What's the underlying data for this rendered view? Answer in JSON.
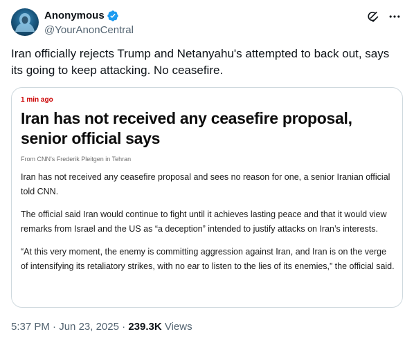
{
  "author": {
    "display_name": "Anonymous",
    "handle": "@YourAnonCentral"
  },
  "icons": {
    "avatar": "hooded-figure-avatar",
    "verified": "verified-badge-icon",
    "grok": "grok-icon",
    "more": "more-icon"
  },
  "colors": {
    "verified_blue": "#1d9bf0",
    "text_primary": "#0f1419",
    "text_secondary": "#536471",
    "card_border": "#cfd9de",
    "article_time_red": "#cc0000"
  },
  "tweet": {
    "text": "Iran officially rejects Trump and Netanyahu's attempted to back out, says its going to keep attacking. No ceasefire."
  },
  "card": {
    "time_ago": "1 min ago",
    "headline": "Iran has not received any ceasefire proposal, senior official says",
    "byline": "From CNN's Frederik Pleitgen in Tehran",
    "paragraphs": [
      "Iran has not received any ceasefire proposal and sees no reason for one, a senior Iranian official told CNN.",
      "The official said Iran would continue to fight until it achieves lasting peace and that it would view remarks from Israel and the US as “a deception” intended to justify attacks on Iran’s interests.",
      "“At this very moment, the enemy is committing aggression against Iran, and Iran is on the verge of intensifying its retaliatory strikes, with no ear to listen to the lies of its enemies,” the official said."
    ]
  },
  "meta": {
    "time": "5:37 PM",
    "date": "Jun 23, 2025",
    "separator": " · ",
    "views_count": "239.3K",
    "views_label": " Views"
  }
}
